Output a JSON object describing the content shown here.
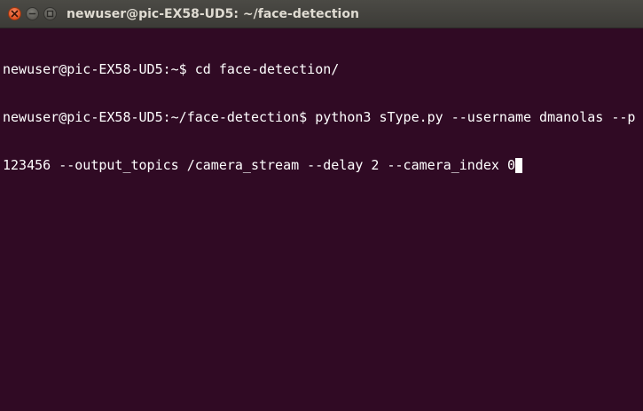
{
  "window": {
    "title": "newuser@pic-EX58-UD5: ~/face-detection",
    "controls": {
      "close": "close-icon",
      "minimize": "minimize-icon",
      "maximize": "maximize-icon"
    },
    "colors": {
      "background": "#300a24",
      "text": "#ffffff",
      "titlebar": "#3c3b37",
      "close": "#e2501f"
    }
  },
  "terminal": {
    "lines": [
      "newuser@pic-EX58-UD5:~$ cd face-detection/",
      "newuser@pic-EX58-UD5:~/face-detection$ python3 sType.py --username dmanolas --p",
      "123456 --output_topics /camera_stream --delay 2 --camera_index 0"
    ]
  }
}
